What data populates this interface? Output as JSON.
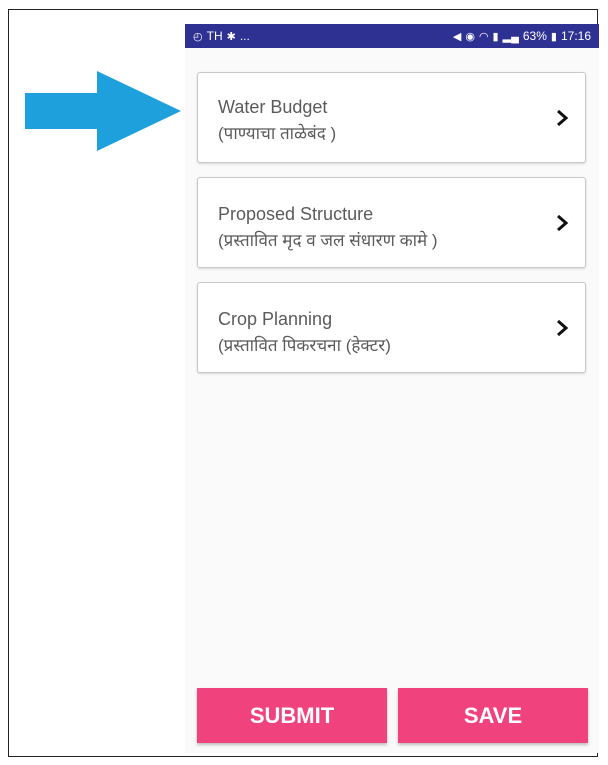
{
  "status_bar": {
    "left_icons": [
      "clock-icon",
      "signal-tag",
      "app-notification-icon"
    ],
    "left_text": "TH",
    "left_more": "...",
    "battery": "63%",
    "time": "17:16"
  },
  "menu": [
    {
      "title": "Water Budget",
      "subtitle": "(पाण्याचा ताळेबंद )"
    },
    {
      "title": "Proposed Structure",
      "subtitle": "(प्रस्तावित मृद व जल संधारण कामे )"
    },
    {
      "title": "Crop Planning",
      "subtitle": "(प्रस्तावित पिकरचना (हेक्टर)"
    }
  ],
  "buttons": {
    "submit": "SUBMIT",
    "save": "SAVE"
  },
  "colors": {
    "status_bar": "#2e3192",
    "button": "#f0437e",
    "pointer_arrow": "#1ea0dc"
  }
}
